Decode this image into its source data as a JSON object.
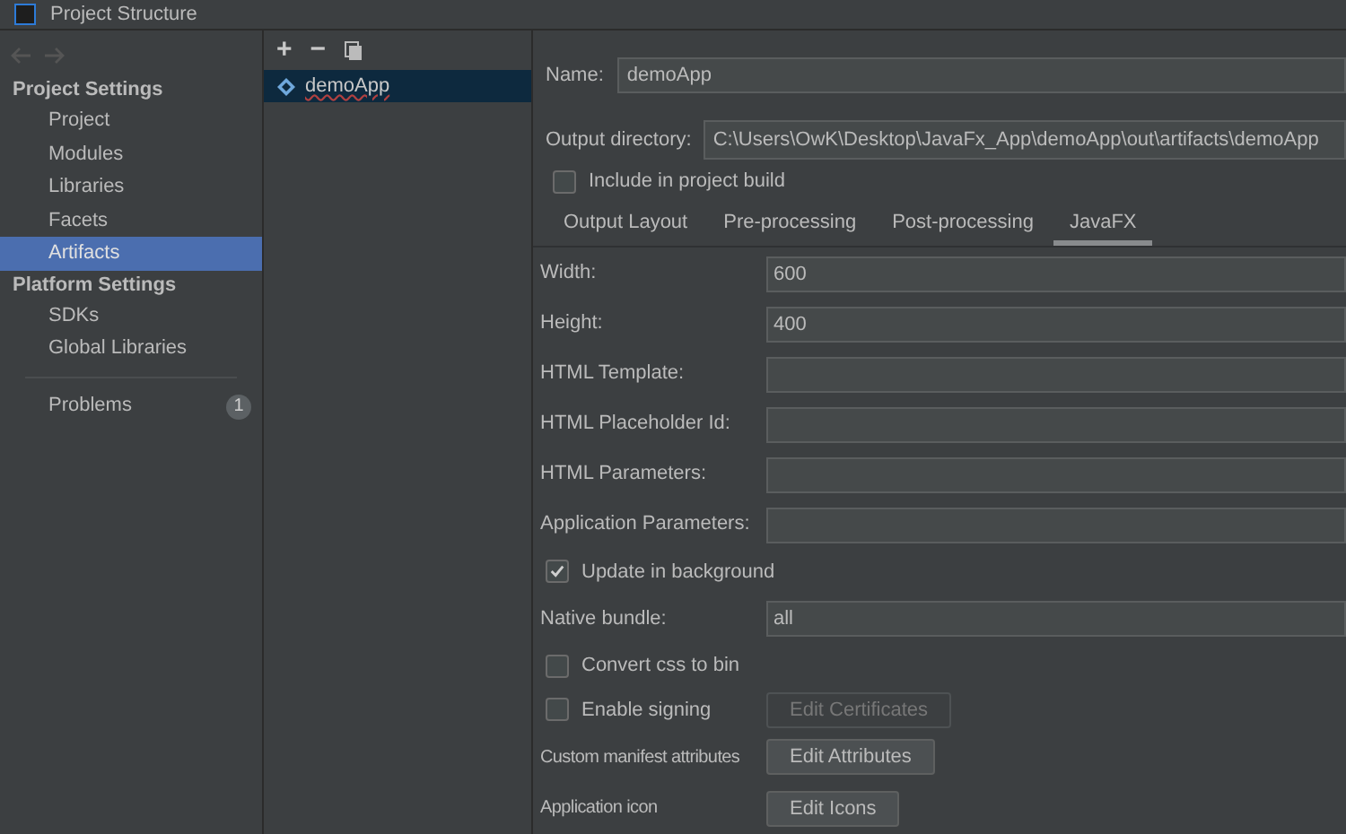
{
  "window": {
    "title": "Project Structure"
  },
  "sidebar": {
    "sections": [
      {
        "title": "Project Settings",
        "items": [
          {
            "label": "Project",
            "selected": false
          },
          {
            "label": "Modules",
            "selected": false
          },
          {
            "label": "Libraries",
            "selected": false
          },
          {
            "label": "Facets",
            "selected": false
          },
          {
            "label": "Artifacts",
            "selected": true
          }
        ]
      },
      {
        "title": "Platform Settings",
        "items": [
          {
            "label": "SDKs",
            "selected": false
          },
          {
            "label": "Global Libraries",
            "selected": false
          }
        ]
      }
    ],
    "problems": {
      "label": "Problems",
      "count": "1"
    }
  },
  "artifacts": {
    "toolbar": [
      "+",
      "−"
    ],
    "items": [
      {
        "label": "demoApp",
        "selected": true
      }
    ]
  },
  "name": {
    "label": "Name:",
    "value": "demoApp"
  },
  "output_directory": {
    "label": "Output directory:",
    "value": "C:\\Users\\OwK\\Desktop\\JavaFx_App\\demoApp\\out\\artifacts\\demoApp"
  },
  "include_in_build": {
    "label": "Include in project build",
    "checked": false
  },
  "tabs": [
    {
      "label": "Output Layout",
      "selected": false
    },
    {
      "label": "Pre-processing",
      "selected": false
    },
    {
      "label": "Post-processing",
      "selected": false
    },
    {
      "label": "JavaFX",
      "selected": true
    }
  ],
  "form": [
    {
      "kind": "field",
      "label": "Width:",
      "value": "600"
    },
    {
      "kind": "field",
      "label": "Height:",
      "value": "400"
    },
    {
      "kind": "field",
      "label": "HTML Template:"
    },
    {
      "kind": "field",
      "label": "HTML Placeholder Id:"
    },
    {
      "kind": "field",
      "label": "HTML Parameters:"
    },
    {
      "kind": "field",
      "label": "Application Parameters:"
    },
    {
      "kind": "checkbox",
      "label": "Update in background",
      "checked": true
    },
    {
      "kind": "field",
      "label": "Native bundle:",
      "value": "all"
    },
    {
      "kind": "checkbox",
      "label": "Convert css to bin",
      "checked": false
    },
    {
      "kind": "checkbox",
      "label": "Enable signing",
      "checked": false,
      "button": {
        "label": "Edit Certificates",
        "disabled": true
      }
    },
    {
      "kind": "button",
      "label": "Custom manifest attributes",
      "button": {
        "label": "Edit  Attributes",
        "disabled": false
      }
    },
    {
      "kind": "button",
      "label": "Application icon",
      "button": {
        "label": "Edit Icons",
        "disabled": false
      }
    }
  ]
}
